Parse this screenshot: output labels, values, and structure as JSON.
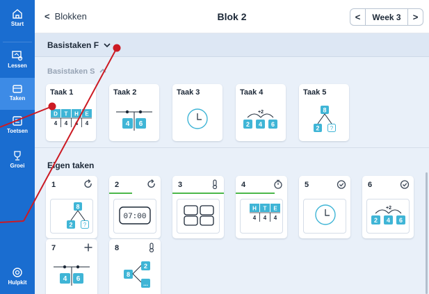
{
  "sidebar": {
    "items": [
      {
        "label": "Start",
        "icon": "home-icon"
      },
      {
        "label": "Lessen",
        "icon": "lessons-icon"
      },
      {
        "label": "Taken",
        "icon": "tasks-icon"
      },
      {
        "label": "Toetsen",
        "icon": "tests-icon"
      },
      {
        "label": "Groei",
        "icon": "trophy-icon"
      },
      {
        "label": "Hulpkit",
        "icon": "lifebuoy-icon"
      }
    ],
    "active": "Taken",
    "colors": {
      "background": "#1a6dd0",
      "active": "#3d8be6"
    }
  },
  "header": {
    "back_label": "Blokken",
    "title": "Blok 2",
    "week_label": "Week 3",
    "prev_glyph": "<",
    "next_glyph": ">",
    "back_glyph": "<"
  },
  "sections": {
    "basistaken_f": "Basistaken F",
    "basistaken_s": "Basistaken S",
    "eigen_taken": "Eigen taken"
  },
  "basistaken": [
    {
      "label": "Taak 1",
      "art": "place-value-grid"
    },
    {
      "label": "Taak 2",
      "art": "number-line-4-6"
    },
    {
      "label": "Taak 3",
      "art": "clock"
    },
    {
      "label": "Taak 4",
      "art": "jump-2-4-6"
    },
    {
      "label": "Taak 5",
      "art": "split-tree"
    }
  ],
  "place_value": {
    "headers": [
      "D",
      "T",
      "H",
      "E"
    ],
    "digits": [
      "4",
      "4",
      "4",
      "4"
    ]
  },
  "place_value_hte": {
    "headers": [
      "H",
      "T",
      "E"
    ],
    "digits": [
      "4",
      "4",
      "4"
    ]
  },
  "number_line": {
    "left": "4",
    "right": "6"
  },
  "jump": {
    "label": "+2",
    "values": [
      "2",
      "4",
      "6"
    ]
  },
  "split_tree": {
    "top": "8",
    "left": "2",
    "right": "?"
  },
  "split_tree_left": {
    "root": "8",
    "top": "2",
    "bottom": "..."
  },
  "digital_clock": "07:00",
  "eigen_taken": [
    {
      "num": "1",
      "status_icon": "repeat-icon",
      "progress": 0,
      "art": "split-tree"
    },
    {
      "num": "2",
      "status_icon": "repeat-icon",
      "progress": 0.45,
      "art": "digital-clock"
    },
    {
      "num": "3",
      "status_icon": "thermometer-icon",
      "progress": 1.0,
      "art": "four-boxes"
    },
    {
      "num": "4",
      "status_icon": "timer-icon",
      "progress": 0.75,
      "art": "place-value-hte"
    },
    {
      "num": "5",
      "status_icon": "check-circle-icon",
      "progress": 0,
      "art": "clock"
    },
    {
      "num": "6",
      "status_icon": "check-circle-icon",
      "progress": 0,
      "art": "jump-2-4-6"
    },
    {
      "num": "7",
      "status_icon": "plus-icon",
      "progress": 0,
      "art": "number-line-4-6"
    },
    {
      "num": "8",
      "status_icon": "thermometer-icon",
      "progress": 0,
      "art": "split-tree-left"
    }
  ],
  "colors": {
    "accent": "#1a6dd0",
    "tile_teal": "#3fb5d6",
    "progress_green": "#4bb84a",
    "annotation_red": "#cc1a23",
    "content_bg": "#e9f0f9"
  }
}
